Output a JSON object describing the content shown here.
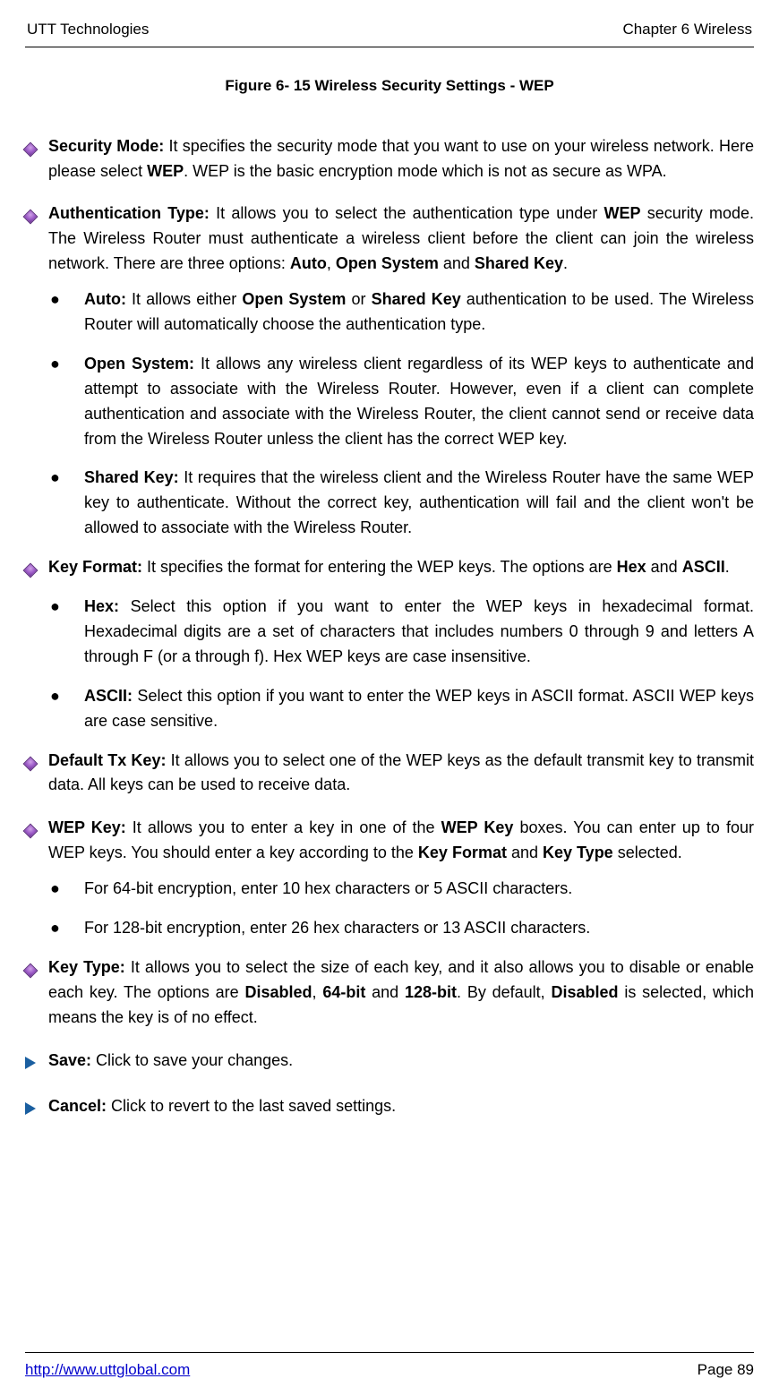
{
  "header": {
    "left": "UTT Technologies",
    "right": "Chapter 6 Wireless"
  },
  "figure_caption": "Figure 6- 15 Wireless Security Settings - WEP",
  "items": {
    "security_mode": {
      "label": "Security Mode:",
      "t1": " It specifies the security mode that you want to use on your wireless network. Here please select ",
      "b1": "WEP",
      "t2": ". WEP is the basic encryption mode which is not as secure as WPA."
    },
    "auth_type": {
      "label": "Authentication Type:",
      "t1": " It allows you to select the authentication type under ",
      "b1": "WEP",
      "t2": " security mode. The Wireless Router must authenticate a wireless client before the client can join the wireless network. There are three options: ",
      "b2": "Auto",
      "t3": ", ",
      "b3": "Open System",
      "t4": " and ",
      "b4": "Shared Key",
      "t5": ".",
      "auto": {
        "label": "Auto:",
        "t1": " It allows either ",
        "b1": "Open System",
        "t2": " or ",
        "b2": "Shared Key",
        "t3": " authentication to be used. The Wireless Router will automatically choose the authentication type."
      },
      "open": {
        "label": "Open System:",
        "t1": " It allows any wireless client regardless of its WEP keys to authenticate and attempt to associate with the Wireless Router. However, even if a client can complete authentication and associate with the Wireless Router, the client cannot send or receive data from the Wireless Router unless the client has the correct WEP key."
      },
      "shared": {
        "label": "Shared Key:",
        "t1": " It requires that the wireless client and the Wireless Router have the same WEP key to authenticate. Without the correct key, authentication will fail and the client won't be allowed to associate with the Wireless Router."
      }
    },
    "key_format": {
      "label": "Key Format:",
      "t1": " It specifies the format for entering the WEP keys. The options are ",
      "b1": "Hex",
      "t2": " and ",
      "b2": "ASCII",
      "t3": ".",
      "hex": {
        "label": "Hex:",
        "t1": " Select this option if you want to enter the WEP keys in hexadecimal format. Hexadecimal digits are a set of characters that includes numbers 0 through 9 and letters A through F (or a through f). Hex WEP keys are case insensitive."
      },
      "ascii": {
        "label": "ASCII:",
        "t1": " Select this option if you want to enter the WEP keys in ASCII format. ASCII WEP keys are case sensitive."
      }
    },
    "default_tx": {
      "label": "Default Tx Key:",
      "t1": " It allows you to select one of the WEP keys as the default transmit key to transmit data. All keys can be used to receive data."
    },
    "wep_key": {
      "label": "WEP Key:",
      "t1": " It allows you to enter a key in one of the ",
      "b1": "WEP Key",
      "t2": " boxes. You can enter up to four WEP keys. You should enter a key according to the ",
      "b2": "Key Format",
      "t3": " and ",
      "b3": "Key Type",
      "t4": " selected.",
      "s1": "For 64-bit encryption, enter 10 hex characters or 5 ASCII characters.",
      "s2": "For 128-bit encryption, enter 26 hex characters or 13 ASCII characters."
    },
    "key_type": {
      "label": "Key Type:",
      "t1": " It allows you to select the size of each key, and it also allows you to disable or enable each key. The options are ",
      "b1": "Disabled",
      "t2": ", ",
      "b2": "64-bit",
      "t3": " and ",
      "b3": "128-bit",
      "t4": ". By default, ",
      "b4": "Disabled",
      "t5": " is selected, which means the key is of no effect."
    },
    "save": {
      "label": "Save:",
      "t1": " Click to save your changes."
    },
    "cancel": {
      "label": "Cancel:",
      "t1": " Click to revert to the last saved settings."
    }
  },
  "footer": {
    "url": "http://www.uttglobal.com",
    "page": "Page 89"
  }
}
